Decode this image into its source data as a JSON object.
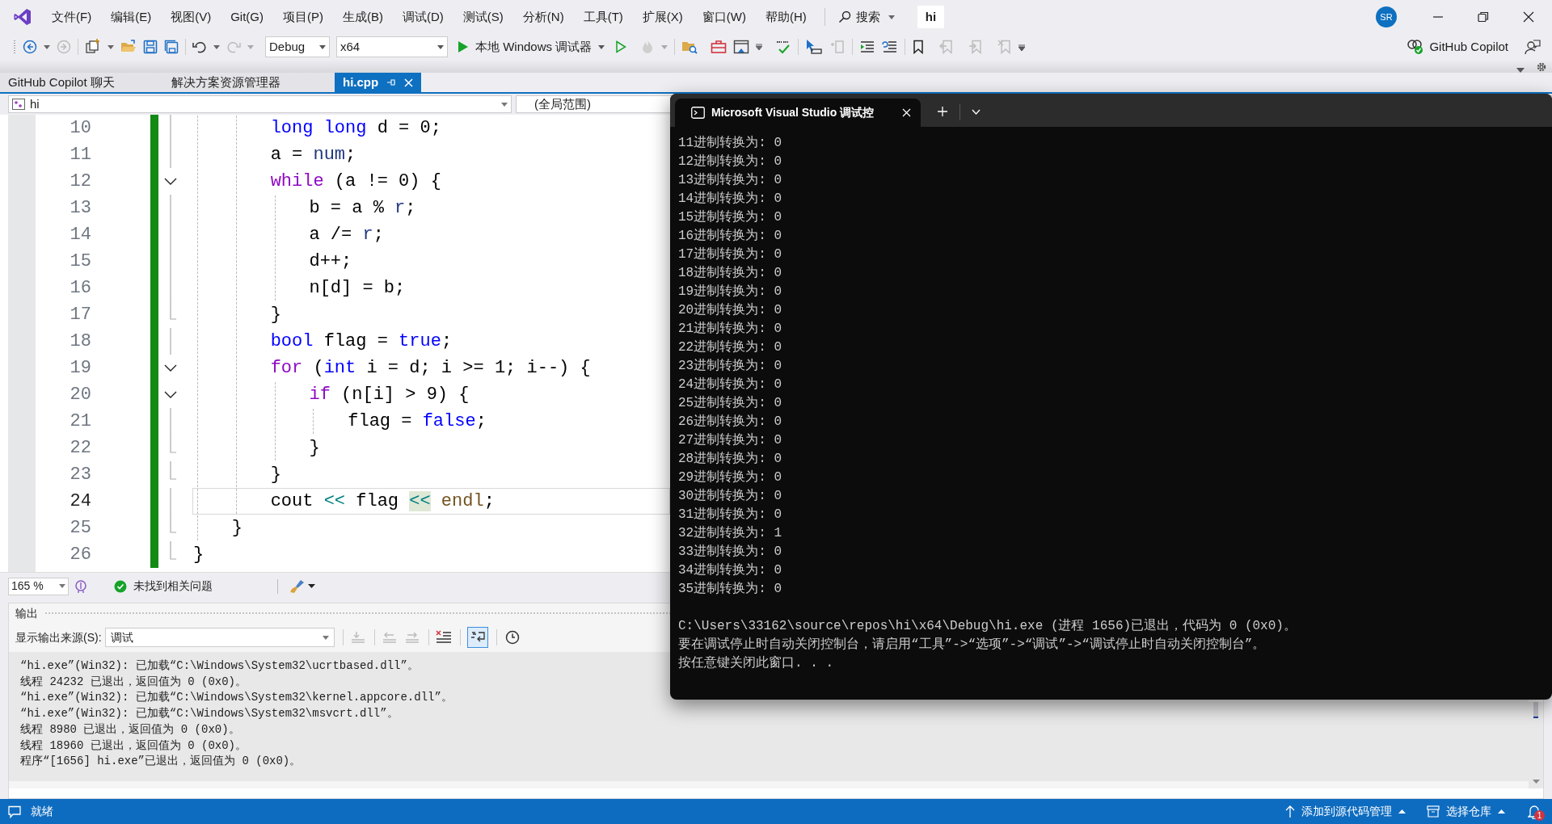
{
  "menu": [
    "文件(F)",
    "编辑(E)",
    "视图(V)",
    "Git(G)",
    "项目(P)",
    "生成(B)",
    "调试(D)",
    "测试(S)",
    "分析(N)",
    "工具(T)",
    "扩展(X)",
    "窗口(W)",
    "帮助(H)"
  ],
  "search": "搜索",
  "solution": "hi",
  "avatar": "SR",
  "toolbar": {
    "configuration": "Debug",
    "platform": "x64",
    "debugger": "本地 Windows 调试器",
    "copilot": "GitHub Copilot"
  },
  "tabs": [
    {
      "label": "GitHub Copilot 聊天",
      "selected": false
    },
    {
      "label": "解决方案资源管理器",
      "selected": false
    },
    {
      "label": "hi.cpp",
      "selected": true
    }
  ],
  "navigation": {
    "project": "hi",
    "scope": "(全局范围)"
  },
  "editor": {
    "lines": [
      {
        "number": "10",
        "kind": "plain",
        "changed": true,
        "current": false,
        "code": [
          {
            "kind": "kw",
            "text": "        long long"
          },
          {
            "kind": "text",
            "text": " d = 0;"
          }
        ]
      },
      {
        "number": "11",
        "kind": "plain",
        "changed": true,
        "current": false,
        "code": [
          {
            "kind": "text",
            "text": "        a = "
          },
          {
            "kind": "param",
            "text": "num"
          },
          {
            "kind": "text",
            "text": ";"
          }
        ]
      },
      {
        "number": "12",
        "kind": "fold-start",
        "changed": true,
        "current": false,
        "code": [
          {
            "kind": "ctrl",
            "text": "        while"
          },
          {
            "kind": "text",
            "text": " (a != 0) {"
          }
        ]
      },
      {
        "number": "13",
        "kind": "plain",
        "changed": true,
        "current": false,
        "code": [
          {
            "kind": "text",
            "text": "            b = a % "
          },
          {
            "kind": "param",
            "text": "r"
          },
          {
            "kind": "text",
            "text": ";"
          }
        ]
      },
      {
        "number": "14",
        "kind": "plain",
        "changed": true,
        "current": false,
        "code": [
          {
            "kind": "text",
            "text": "            a /= "
          },
          {
            "kind": "param",
            "text": "r"
          },
          {
            "kind": "text",
            "text": ";"
          }
        ]
      },
      {
        "number": "15",
        "kind": "plain",
        "changed": true,
        "current": false,
        "code": [
          {
            "kind": "text",
            "text": "            d++;"
          }
        ]
      },
      {
        "number": "16",
        "kind": "plain",
        "changed": true,
        "current": false,
        "code": [
          {
            "kind": "text",
            "text": "            n[d] = b;"
          }
        ]
      },
      {
        "number": "17",
        "kind": "fold-end",
        "changed": true,
        "current": false,
        "code": [
          {
            "kind": "text",
            "text": "        }"
          }
        ]
      },
      {
        "number": "18",
        "kind": "plain",
        "changed": true,
        "current": false,
        "code": [
          {
            "kind": "kw",
            "text": "        bool"
          },
          {
            "kind": "text",
            "text": " flag = "
          },
          {
            "kind": "kw",
            "text": "true"
          },
          {
            "kind": "text",
            "text": ";"
          }
        ]
      },
      {
        "number": "19",
        "kind": "fold-start",
        "changed": true,
        "current": false,
        "code": [
          {
            "kind": "ctrl",
            "text": "        for"
          },
          {
            "kind": "text",
            "text": " ("
          },
          {
            "kind": "kw",
            "text": "int"
          },
          {
            "kind": "text",
            "text": " i = d; i >= 1; i--) {"
          }
        ]
      },
      {
        "number": "20",
        "kind": "fold-start",
        "changed": true,
        "current": false,
        "code": [
          {
            "kind": "ctrl",
            "text": "            if"
          },
          {
            "kind": "text",
            "text": " (n[i] > 9) {"
          }
        ]
      },
      {
        "number": "21",
        "kind": "plain",
        "changed": true,
        "current": false,
        "code": [
          {
            "kind": "text",
            "text": "                flag = "
          },
          {
            "kind": "kw",
            "text": "false"
          },
          {
            "kind": "text",
            "text": ";"
          }
        ]
      },
      {
        "number": "22",
        "kind": "fold-end",
        "changed": true,
        "current": false,
        "code": [
          {
            "kind": "text",
            "text": "            }"
          }
        ]
      },
      {
        "number": "23",
        "kind": "fold-end",
        "changed": true,
        "current": false,
        "code": [
          {
            "kind": "text",
            "text": "        }"
          }
        ]
      },
      {
        "number": "24",
        "kind": "plain",
        "changed": true,
        "current": true,
        "code": [
          {
            "kind": "text",
            "text": "        cout "
          },
          {
            "kind": "op",
            "text": "<<"
          },
          {
            "kind": "text",
            "text": " flag "
          },
          {
            "kind": "op-match",
            "text": "<<"
          },
          {
            "kind": "fn",
            "text": " endl"
          },
          {
            "kind": "text",
            "text": ";"
          }
        ]
      },
      {
        "number": "25",
        "kind": "fold-end",
        "changed": true,
        "current": false,
        "code": [
          {
            "kind": "text",
            "text": "    }"
          }
        ]
      },
      {
        "number": "26",
        "kind": "fold-end",
        "changed": true,
        "current": false,
        "code": [
          {
            "kind": "text",
            "text": "}"
          }
        ]
      }
    ]
  },
  "editor_status": {
    "zoom": "165 %",
    "issues": "未找到相关问题"
  },
  "output": {
    "title": "输出",
    "source_label": "显示输出来源(S):",
    "source": "调试",
    "word_wrap": true,
    "lines": [
      "“hi.exe”(Win32): 已加载“C:\\Windows\\System32\\ucrtbased.dll”。",
      "线程 24232 已退出，返回值为 0 (0x0)。",
      "“hi.exe”(Win32): 已加载“C:\\Windows\\System32\\kernel.appcore.dll”。",
      "“hi.exe”(Win32): 已加载“C:\\Windows\\System32\\msvcrt.dll”。",
      "线程 8980 已退出，返回值为 0 (0x0)。",
      "线程 18960 已退出，返回值为 0 (0x0)。",
      "程序“[1656] hi.exe”已退出，返回值为 0 (0x0)。"
    ]
  },
  "console": {
    "title": "Microsoft Visual Studio 调试控",
    "results": [
      "11进制转换为: 0",
      "12进制转换为: 0",
      "13进制转换为: 0",
      "14进制转换为: 0",
      "15进制转换为: 0",
      "16进制转换为: 0",
      "17进制转换为: 0",
      "18进制转换为: 0",
      "19进制转换为: 0",
      "20进制转换为: 0",
      "21进制转换为: 0",
      "22进制转换为: 0",
      "23进制转换为: 0",
      "24进制转换为: 0",
      "25进制转换为: 0",
      "26进制转换为: 0",
      "27进制转换为: 0",
      "28进制转换为: 0",
      "29进制转换为: 0",
      "30进制转换为: 0",
      "31进制转换为: 0",
      "32进制转换为: 1",
      "33进制转换为: 0",
      "34进制转换为: 0",
      "35进制转换为: 0"
    ],
    "messages": [
      "C:\\Users\\33162\\source\\repos\\hi\\x64\\Debug\\hi.exe (进程 1656)已退出，代码为 0 (0x0)。",
      "要在调试停止时自动关闭控制台，请启用“工具”->“选项”->“调试”->“调试停止时自动关闭控制台”。",
      "按任意键关闭此窗口. . ."
    ]
  },
  "status_bar": {
    "state": "就绪",
    "source_control": "添加到源代码管理",
    "repository": "选择仓库",
    "notifications": "1"
  }
}
